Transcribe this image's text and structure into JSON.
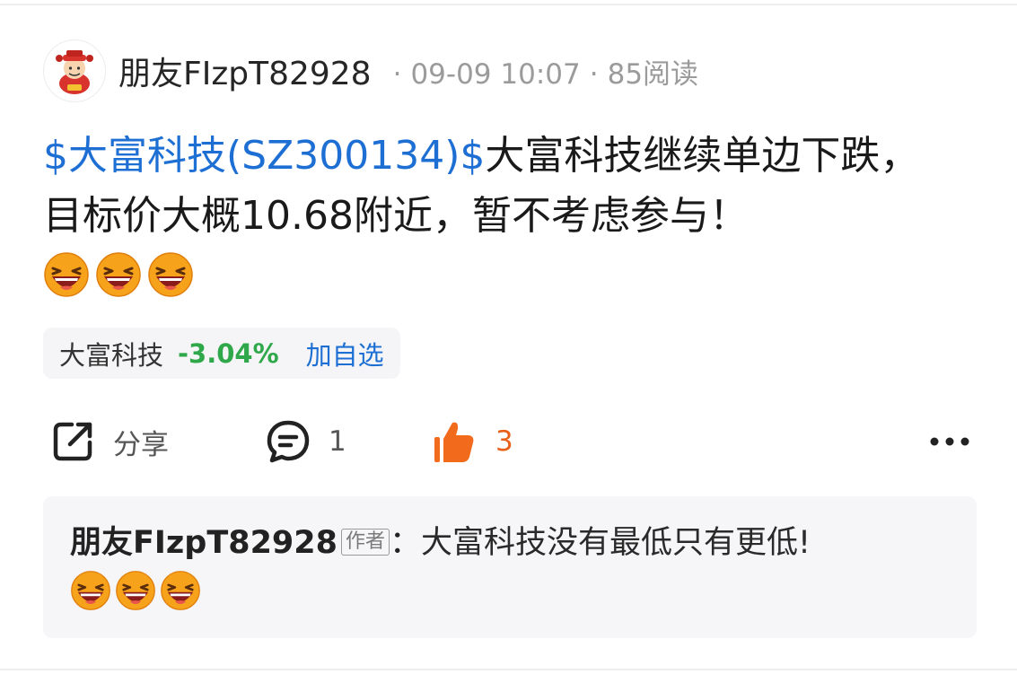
{
  "header": {
    "author": "朋友FIzpT82928",
    "separator": "·",
    "datetime": "09-09 10:07",
    "reads": "85阅读",
    "avatar_icon": "fortune-god-avatar"
  },
  "post": {
    "stock_tag": "$大富科技(SZ300134)$",
    "text": "大富科技继续单边下跌，目标价大概10.68附近，暂不考虑参与！",
    "emojis": [
      "laughing-emoji",
      "laughing-emoji",
      "laughing-emoji"
    ]
  },
  "stock_chip": {
    "name": "大富科技",
    "change": "-3.04%",
    "add_label": "加自选"
  },
  "actions": {
    "share_label": "分享",
    "comment_count": "1",
    "like_count": "3",
    "share_icon": "share-icon",
    "comment_icon": "comment-icon",
    "like_icon": "thumbs-up-icon",
    "more_icon": "more-icon"
  },
  "comment": {
    "author": "朋友FIzpT82928",
    "badge": "作者",
    "colon": "：",
    "text": "大富科技没有最低只有更低!",
    "emojis": [
      "laughing-emoji",
      "laughing-emoji",
      "laughing-emoji"
    ]
  },
  "colors": {
    "link": "#1e6fd4",
    "change_down": "#2ea84a",
    "like": "#e8601a",
    "card_bg": "#f6f6f8"
  }
}
